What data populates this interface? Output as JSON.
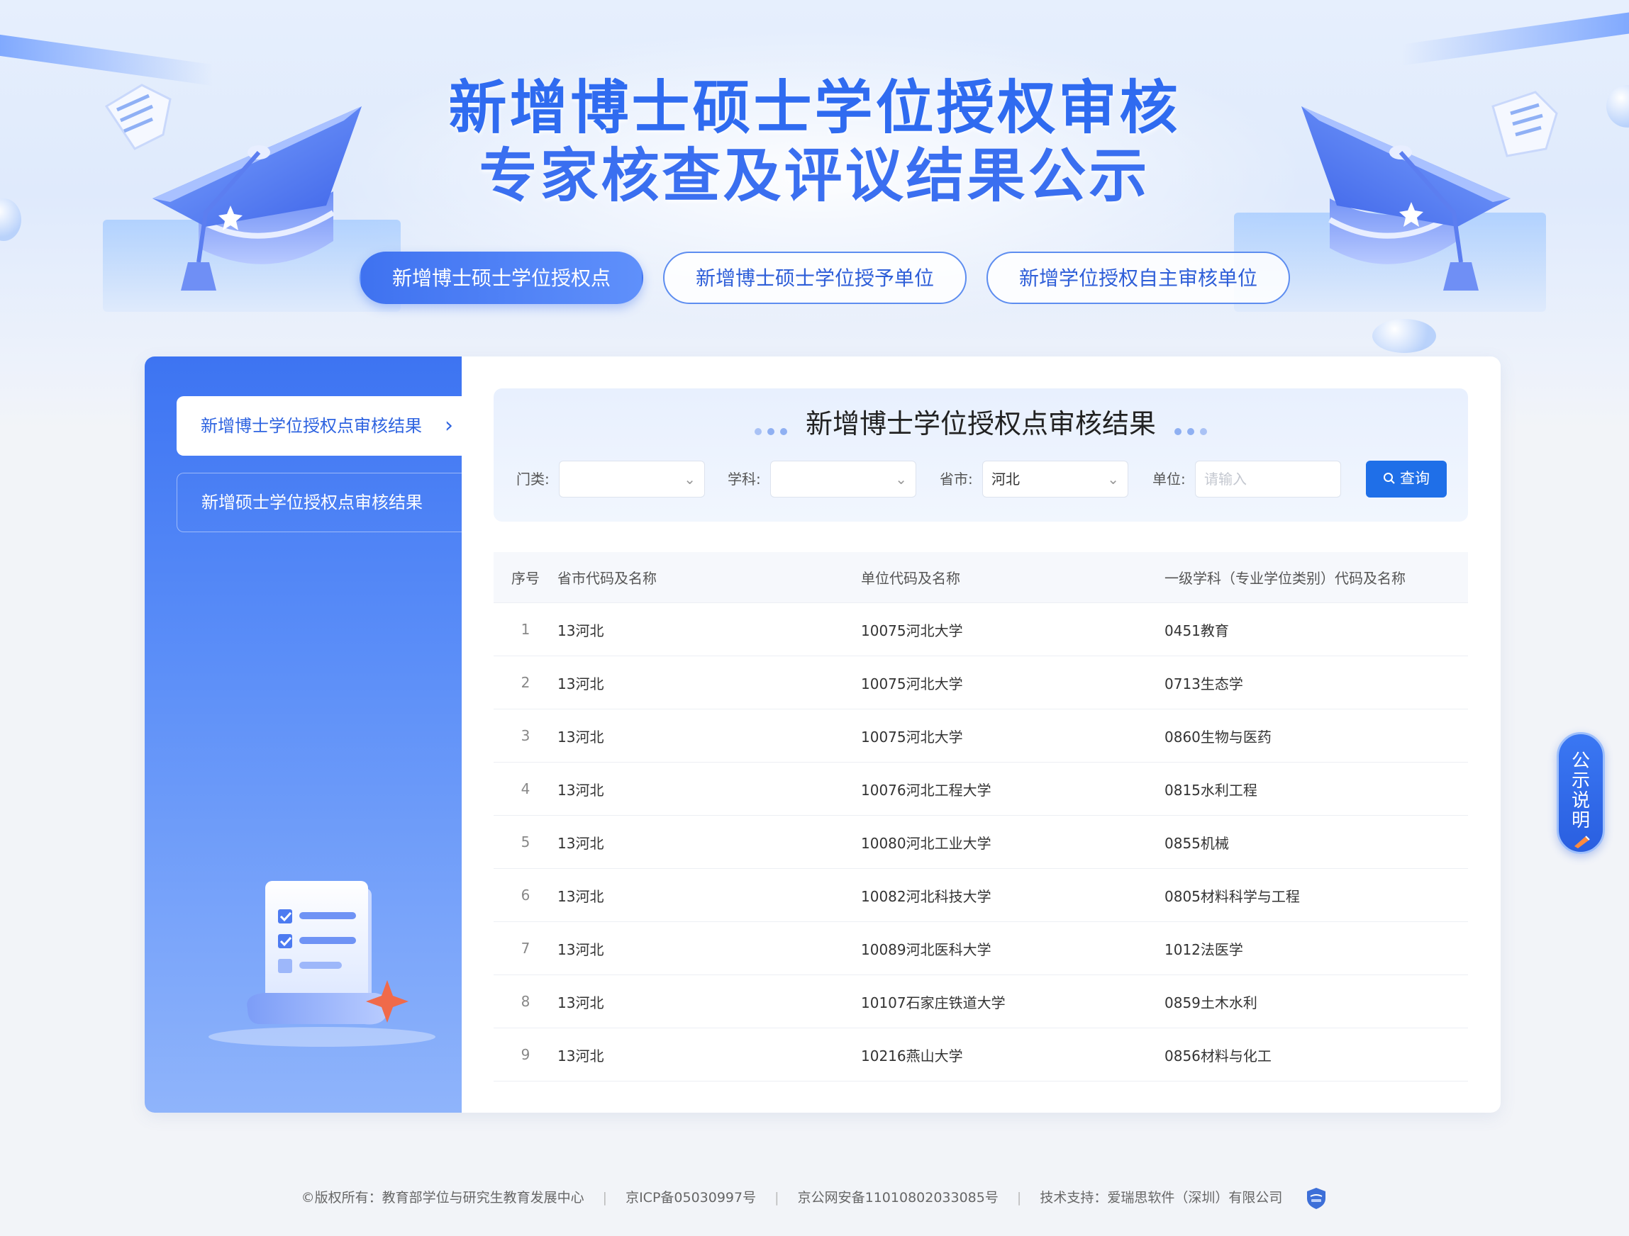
{
  "title": {
    "line1": "新增博士硕士学位授权审核",
    "line2": "专家核查及评议结果公示"
  },
  "top_tabs": [
    {
      "label": "新增博士硕士学位授权点",
      "active": true
    },
    {
      "label": "新增博士硕士学位授予单位",
      "active": false
    },
    {
      "label": "新增学位授权自主审核单位",
      "active": false
    }
  ],
  "sidebar": {
    "items": [
      {
        "label": "新增博士学位授权点审核结果",
        "active": true
      },
      {
        "label": "新增硕士学位授权点审核结果",
        "active": false
      }
    ],
    "chevron_icon": "chevron-right-icon"
  },
  "filter": {
    "title": "新增博士学位授权点审核结果",
    "category_label": "门类:",
    "category_value": "",
    "subject_label": "学科:",
    "subject_value": "",
    "province_label": "省市:",
    "province_value": "河北",
    "unit_label": "单位:",
    "unit_placeholder": "请输入",
    "search_label": "查询",
    "accent": "#1f6fe8"
  },
  "table": {
    "headers": [
      "序号",
      "省市代码及名称",
      "单位代码及名称",
      "一级学科（专业学位类别）代码及名称"
    ],
    "rows": [
      [
        "1",
        "13河北",
        "10075河北大学",
        "0451教育"
      ],
      [
        "2",
        "13河北",
        "10075河北大学",
        "0713生态学"
      ],
      [
        "3",
        "13河北",
        "10075河北大学",
        "0860生物与医药"
      ],
      [
        "4",
        "13河北",
        "10076河北工程大学",
        "0815水利工程"
      ],
      [
        "5",
        "13河北",
        "10080河北工业大学",
        "0855机械"
      ],
      [
        "6",
        "13河北",
        "10082河北科技大学",
        "0805材料科学与工程"
      ],
      [
        "7",
        "13河北",
        "10089河北医科大学",
        "1012法医学"
      ],
      [
        "8",
        "13河北",
        "10107石家庄铁道大学",
        "0859土木水利"
      ],
      [
        "9",
        "13河北",
        "10216燕山大学",
        "0856材料与化工"
      ]
    ]
  },
  "float_tag": {
    "chars": [
      "公",
      "示",
      "说",
      "明"
    ]
  },
  "footer": {
    "copyright": "©版权所有：教育部学位与研究生教育发展中心",
    "icp": "京ICP备05030997号",
    "police": "京公网安备11010802033085号",
    "support": "技术支持：爱瑞思软件（深圳）有限公司"
  },
  "colors": {
    "brand_blue": "#3f72f0",
    "title_blue": "#2f6bf0"
  }
}
